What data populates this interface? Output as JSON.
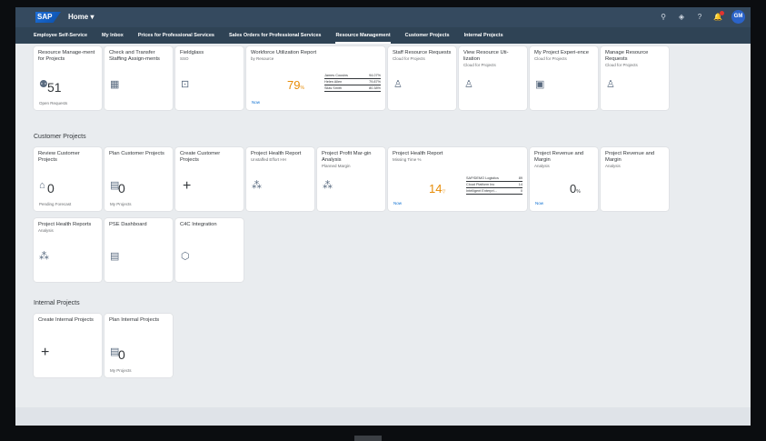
{
  "shell": {
    "logo": "SAP",
    "home": "Home ▾",
    "avatar": "GM",
    "icons": [
      {
        "name": "search-icon",
        "glyph": "⚲"
      },
      {
        "name": "copilot-icon",
        "glyph": "◈"
      },
      {
        "name": "help-icon",
        "glyph": "?"
      },
      {
        "name": "notifications-icon",
        "glyph": "🔔"
      }
    ]
  },
  "tabs": [
    "Employee Self-Service",
    "My Inbox",
    "Prices for Professional Services",
    "Sales Orders for Professional Services",
    "Resource Management",
    "Customer Projects",
    "Internal Projects"
  ],
  "sections": {
    "customer": "Customer Projects",
    "internal": "Internal Projects"
  },
  "tiles_row1": [
    {
      "title": "Resource Manage-ment for Projects",
      "sub": "",
      "num": "51",
      "foot": "Open Requests"
    },
    {
      "title": "Check and Transfer Staffing Assign-ments",
      "sub": ""
    },
    {
      "title": "Fieldglass",
      "sub": "SSO"
    }
  ],
  "workforce": {
    "title": "Workforce Utilization Report",
    "sub": "by Resource",
    "kpi": "79",
    "unit": "%",
    "now": "Now",
    "rows": [
      [
        "James Cousins",
        "94.07%"
      ],
      [
        "Helen Allen",
        "79.87%"
      ],
      [
        "Silas Smith",
        "80.38%"
      ]
    ]
  },
  "tiles_row1b": [
    {
      "title": "Staff Resource Requests",
      "sub": "Cloud for Projects"
    },
    {
      "title": "View Resource Uti-lization",
      "sub": "Cloud for Projects"
    },
    {
      "title": "My Project Experi-ence",
      "sub": "Cloud for Projects"
    },
    {
      "title": "Manage Resource Requests",
      "sub": "Cloud for Projects"
    }
  ],
  "cust_row1": [
    {
      "title": "Review Customer Projects",
      "num": "0",
      "foot": "Pending Forecast"
    },
    {
      "title": "Plan Customer Projects",
      "num": "0",
      "foot": "My Projects"
    },
    {
      "title": "Create Customer Projects"
    },
    {
      "title": "Project Health Report",
      "sub": "Unstaffed Effort HH"
    },
    {
      "title": "Project Profit Mar-gin Analysis",
      "sub": "Planned Margin"
    }
  ],
  "health": {
    "title": "Project Health Report",
    "sub": "Missing Time %",
    "kpi": "14",
    "unit": "▽",
    "now": "Now",
    "rows": [
      [
        "SAP/DEMO Logistics",
        "89"
      ],
      [
        "Cloud Platform Inc",
        "14"
      ],
      [
        "Intelligent Enterpri...",
        "0"
      ]
    ]
  },
  "rev1": {
    "title": "Project Revenue and Margin",
    "sub": "Analysis",
    "kpi": "0",
    "unit": "%",
    "now": "Now"
  },
  "rev2": {
    "title": "Project Revenue and Margin",
    "sub": "Analysis"
  },
  "cust_row2": [
    {
      "title": "Project Health Reports",
      "sub": "Analysis"
    },
    {
      "title": "PSE Dashboard"
    },
    {
      "title": "C4C Integration"
    }
  ],
  "internal": [
    {
      "title": "Create Internal Projects"
    },
    {
      "title": "Plan Internal Projects",
      "num": "0",
      "foot": "My Projects"
    }
  ]
}
